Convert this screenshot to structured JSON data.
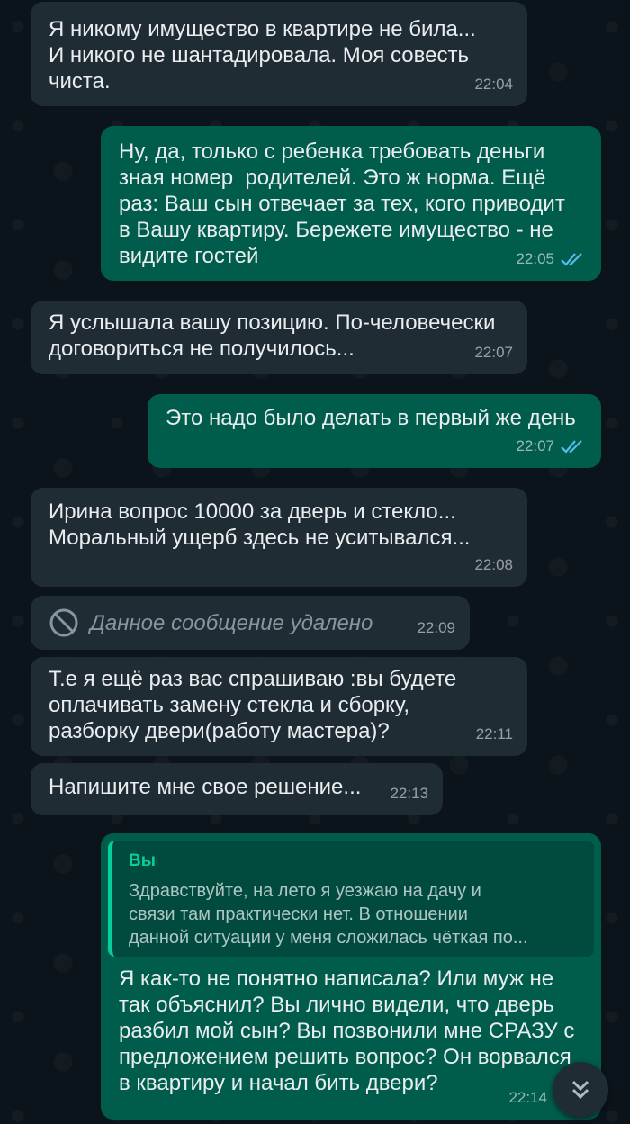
{
  "messages": [
    {
      "dir": "in",
      "text": "Я никому имущество в квартире не била...\nИ никого не шантадировала. Моя совесть\nчиста.",
      "time": "22:04"
    },
    {
      "dir": "out",
      "text": "Ну, да, только с ребенка требовать деньги\nзная номер  родителей. Это ж норма. Ещё\nраз: Ваш сын отвечает за тех, кого приводит\nв Вашу квартиру. Бережете имущество - не\nвидите гостей",
      "time": "22:05",
      "status": "read"
    },
    {
      "dir": "in",
      "text": "Я услышала вашу позицию. По-человечески\nдоговориться не получилось...",
      "time": "22:07"
    },
    {
      "dir": "out",
      "text": "Это надо было делать в первый же день",
      "time": "22:07",
      "status": "read"
    },
    {
      "dir": "in",
      "text": "Ирина вопрос 10000 за дверь и стекло...\nМоральный ущерб здесь не уситывался...",
      "time": "22:08"
    },
    {
      "dir": "in",
      "text": "Данное сообщение удалено",
      "time": "22:09",
      "deleted": true
    },
    {
      "dir": "in",
      "text": "Т.е я ещё раз вас спрашиваю :вы будете\nоплачивать замену стекла и сборку,\nразборку двери(работу мастера)?",
      "time": "22:11"
    },
    {
      "dir": "in",
      "text": "Напишите мне свое решение...",
      "time": "22:13"
    },
    {
      "dir": "out",
      "quote_author": "Вы",
      "quote_text": "Здравствуйте, на лето я уезжаю на дачу и\nсвязи там практически нет. В отношении\nданной ситуации у меня сложилась чёткая по...",
      "text": "Я как-то не понятно написала? Или муж не\nтак объяснил? Вы лично видели, что дверь\nразбил мой сын? Вы позвонили мне СРАЗУ с\nпредложением решить вопрос? Он ворвался\nв квартиру и начал бить двери?",
      "time": "22:14"
    }
  ],
  "colors": {
    "incoming": "#202c33",
    "outgoing": "#005c4b",
    "read_ticks": "#53bdeb",
    "background": "#0b141a"
  },
  "icons": {
    "read_status": "double-check-icon",
    "deleted": "no-entry-icon",
    "scroll": "double-chevron-down-icon"
  }
}
